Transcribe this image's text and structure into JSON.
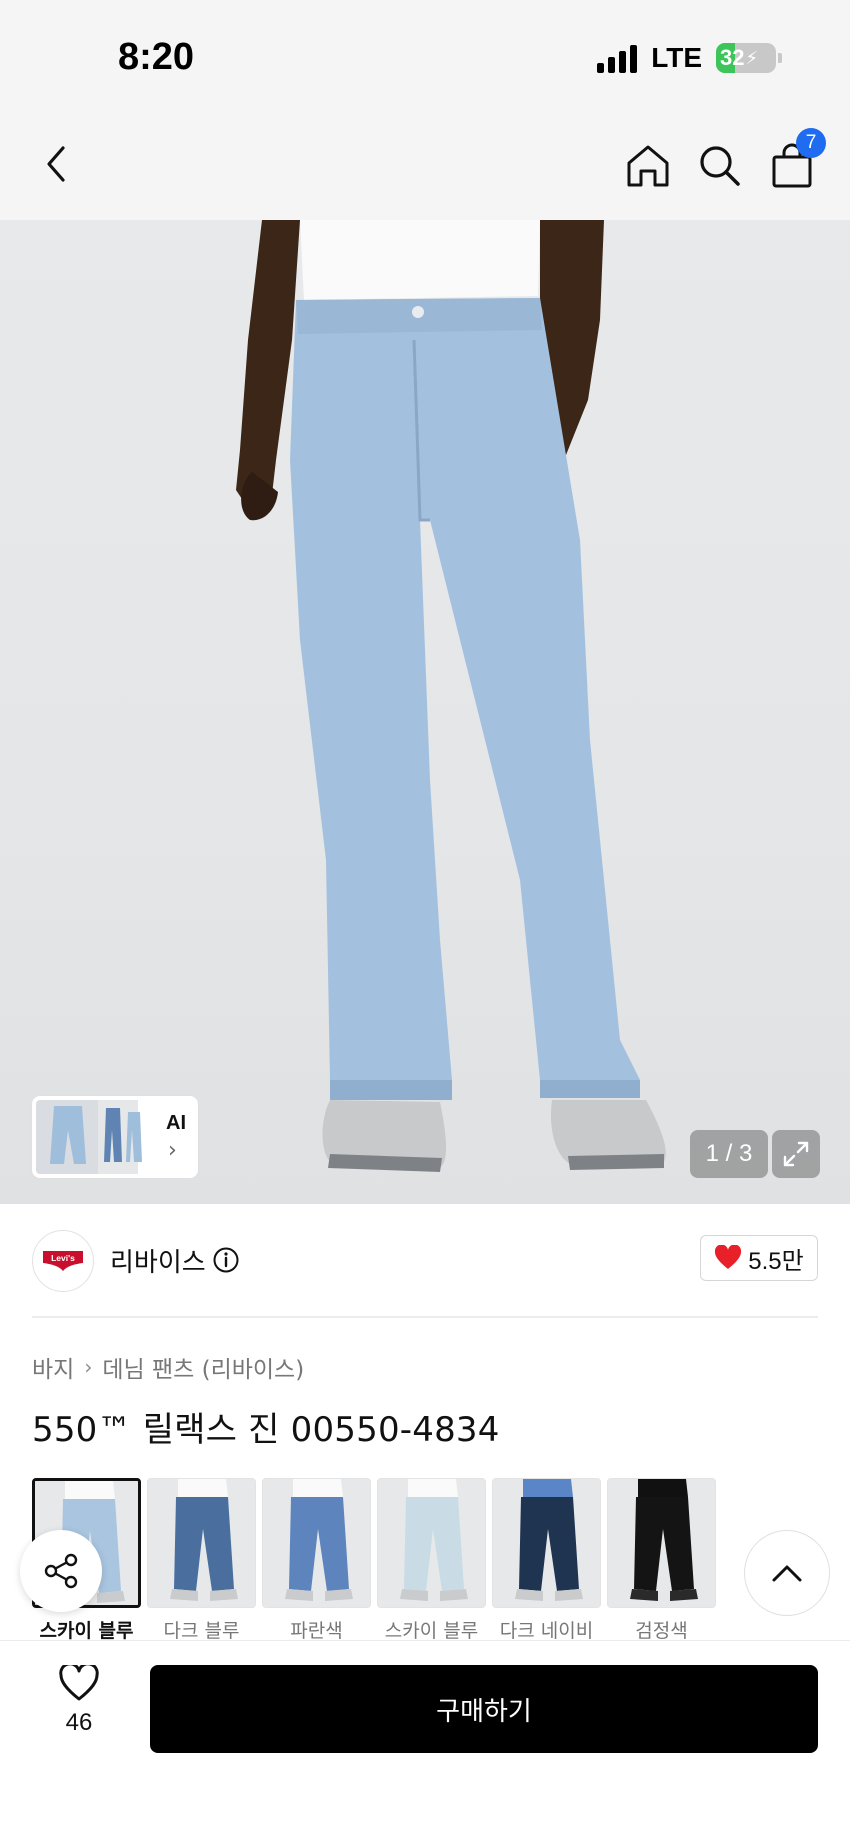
{
  "status_bar": {
    "time": "8:20",
    "network": "LTE",
    "battery": "32",
    "battery_level": 0.32
  },
  "header": {
    "back_icon": "chevron-left-icon",
    "home_icon": "home-icon",
    "search_icon": "search-icon",
    "cart_icon": "shopping-bag-icon",
    "cart_count": "7"
  },
  "gallery": {
    "ai_label": "AI",
    "page_indicator": "1 / 3",
    "expand_icon": "expand-icon"
  },
  "brand": {
    "name": "리바이스",
    "logo_text": "Levi's",
    "likes": "5.5만"
  },
  "breadcrumb": [
    "바지",
    "데님 팬츠 (리바이스)"
  ],
  "product": {
    "title": "550™ 릴랙스 진 00550-4834"
  },
  "colors": [
    {
      "label": "스카이 블루",
      "tone": "#a9c5df",
      "selected": true
    },
    {
      "label": "다크 블루",
      "tone": "#4a6f9e",
      "selected": false
    },
    {
      "label": "파란색",
      "tone": "#5d84bd",
      "selected": false
    },
    {
      "label": "스카이 블루",
      "tone": "#c9dbe4",
      "selected": false
    },
    {
      "label": "다크 네이비",
      "tone": "#1f3450",
      "selected": false
    },
    {
      "label": "검정색",
      "tone": "#141414",
      "selected": false
    }
  ],
  "bottom_bar": {
    "wishlist_count": "46",
    "buy_label": "구매하기"
  },
  "theme": {
    "accent": "#1f6cf1",
    "heart": "#e8202a",
    "denim": "#a3c1de"
  }
}
